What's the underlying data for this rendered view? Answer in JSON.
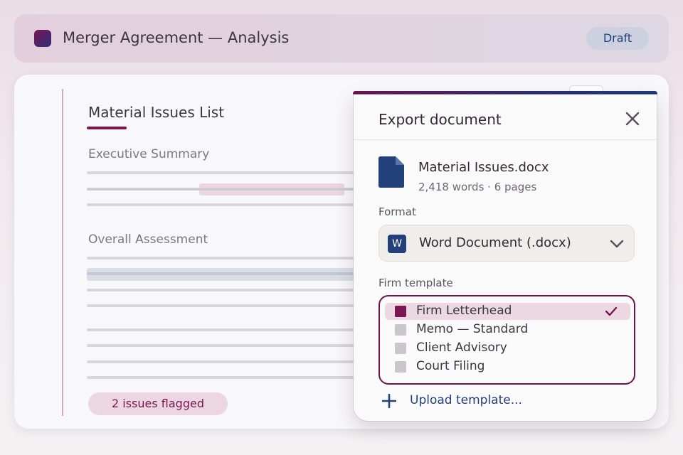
{
  "header": {
    "title": "Merger Agreement — Analysis",
    "status_badge": "Draft",
    "app_icon": "app-logo-icon"
  },
  "document": {
    "heading": "Material Issues List",
    "sections": [
      {
        "label": "Executive Summary"
      },
      {
        "label": "Overall Assessment"
      }
    ],
    "issues_badge": "2 issues flagged"
  },
  "export_dialog": {
    "title": "Export document",
    "close_icon": "close-icon",
    "file": {
      "name": "Material Issues.docx",
      "meta": "2,418 words · 6 pages",
      "icon": "file-icon"
    },
    "format": {
      "label": "Format",
      "selected": "Word Document (.docx)",
      "icon_letter": "W"
    },
    "template": {
      "label": "Firm template",
      "options": [
        {
          "label": "Firm Letterhead",
          "selected": true
        },
        {
          "label": "Memo — Standard",
          "selected": false
        },
        {
          "label": "Client Advisory",
          "selected": false
        },
        {
          "label": "Court Filing",
          "selected": false
        }
      ]
    },
    "upload_label": "Upload template..."
  },
  "colors": {
    "brand": "#7a1651",
    "accent_blue": "#22407a",
    "highlight_pink": "#ebd6e2",
    "highlight_blue": "#d9dde8"
  }
}
